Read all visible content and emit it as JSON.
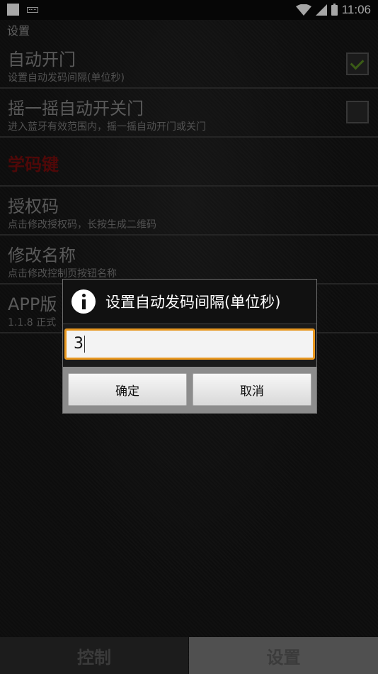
{
  "status_bar": {
    "time": "11:06"
  },
  "app": {
    "title": "设置"
  },
  "preferences": [
    {
      "title": "自动开门",
      "subtitle": "设置自动发码间隔(单位秒)",
      "checked": true
    },
    {
      "title": "摇一摇自动开关门",
      "subtitle": "进入蓝牙有效范围内，摇一摇自动开门或关门",
      "checked": false
    },
    {
      "title": "学码键",
      "title_color": "#7a0d0d"
    },
    {
      "title": "授权码",
      "subtitle": "点击修改授权码，长按生成二维码"
    },
    {
      "title": "修改名称",
      "subtitle": "点击修改控制页按钮名称"
    },
    {
      "title": "APP版",
      "subtitle": "1.1.8 正式"
    }
  ],
  "dialog": {
    "title": "设置自动发码间隔(单位秒)",
    "input_value": "3",
    "ok_label": "确定",
    "cancel_label": "取消",
    "accent_color": "#e8971f"
  },
  "tabs": [
    {
      "label": "控制",
      "active": false
    },
    {
      "label": "设置",
      "active": true
    }
  ]
}
